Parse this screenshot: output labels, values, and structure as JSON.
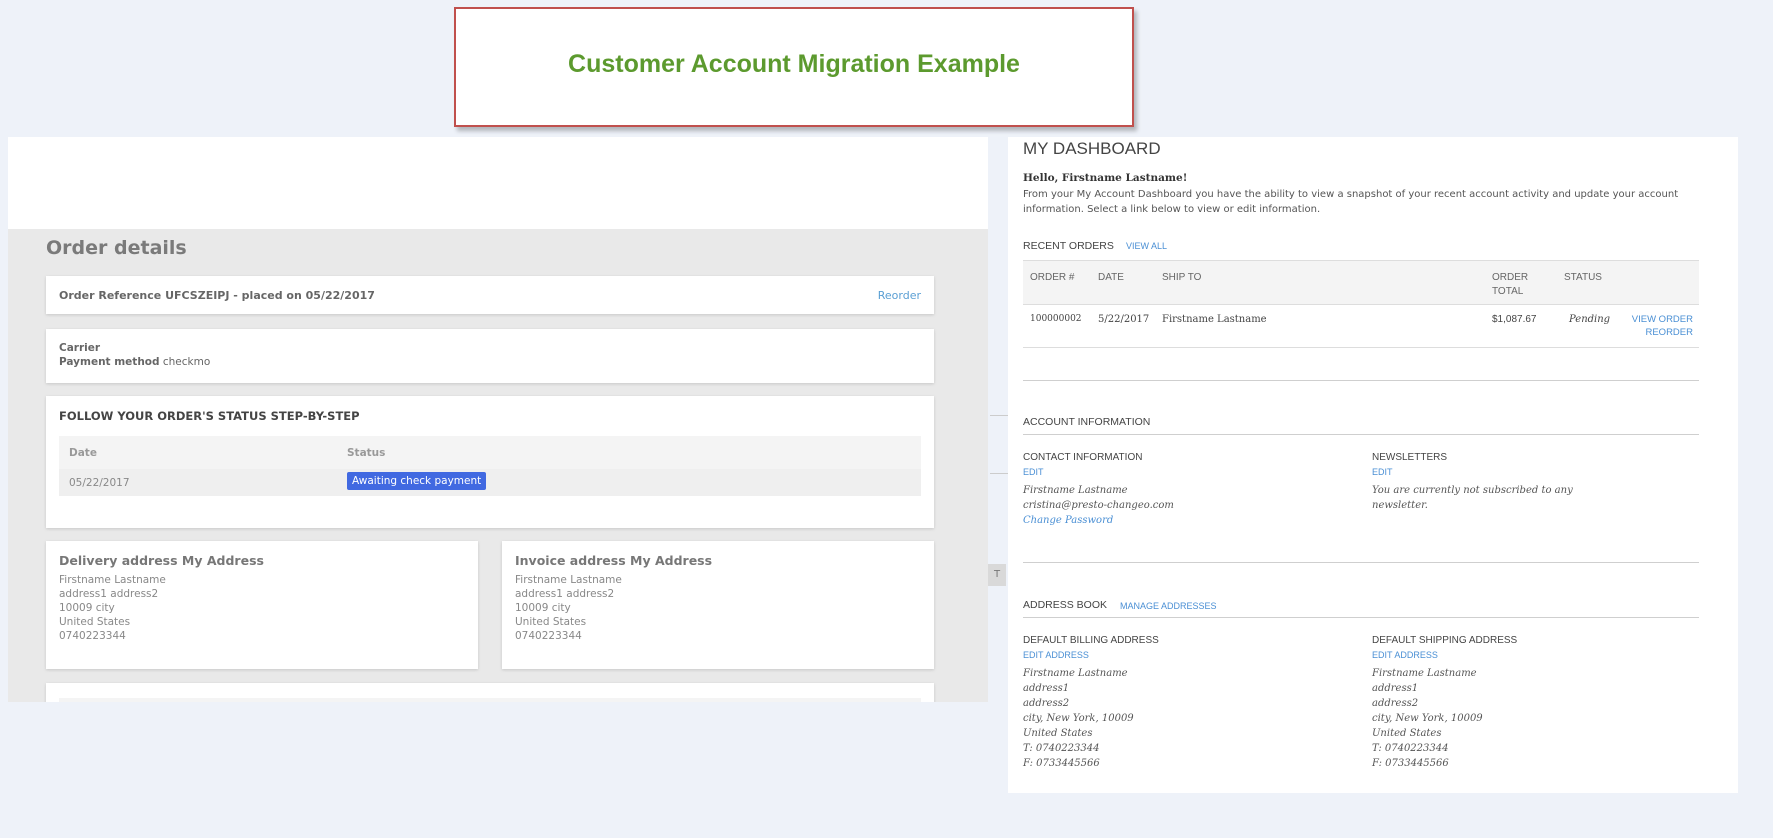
{
  "banner": {
    "title": "Customer Account Migration Example"
  },
  "left": {
    "order_details_title": "Order details",
    "order_reference": "Order Reference UFCSZEIPJ - placed on 05/22/2017",
    "reorder": "Reorder",
    "carrier_label": "Carrier",
    "payment_label": "Payment method",
    "payment_value": "checkmo",
    "follow_title": "FOLLOW YOUR ORDER'S STATUS STEP-BY-STEP",
    "status_table": {
      "headers": [
        "Date",
        "Status"
      ],
      "rows": [
        {
          "date": "05/22/2017",
          "status": "Awaiting check payment"
        }
      ]
    },
    "delivery": {
      "title": "Delivery address My Address",
      "lines": [
        "Firstname Lastname",
        "address1 address2",
        "10009 city",
        "United States",
        "0740223344"
      ]
    },
    "invoice": {
      "title": "Invoice address My Address",
      "lines": [
        "Firstname Lastname",
        "address1 address2",
        "10009 city",
        "United States",
        "0740223344"
      ]
    },
    "side_tab": "T"
  },
  "right": {
    "dashboard_title": "MY DASHBOARD",
    "hello": "Hello, Firstname Lastname!",
    "intro": "From your My Account Dashboard you have the ability to view a snapshot of your recent account activity and update your account information. Select a link below to view or edit information.",
    "recent_orders": "RECENT ORDERS",
    "view_all": "VIEW ALL",
    "orders_table": {
      "headers": {
        "order": "ORDER #",
        "date": "DATE",
        "ship_to": "SHIP TO",
        "total_1": "ORDER",
        "total_2": "TOTAL",
        "status": "STATUS"
      },
      "row": {
        "order": "100000002",
        "date": "5/22/2017",
        "ship_to": "Firstname Lastname",
        "total": "$1,087.67",
        "status": "Pending",
        "view_order": "VIEW ORDER",
        "reorder": "REORDER"
      }
    },
    "account_information": "ACCOUNT INFORMATION",
    "contact_information": "CONTACT INFORMATION",
    "contact_edit": "EDIT",
    "contact_name": "Firstname Lastname",
    "contact_email": "cristina@presto-changeo.com",
    "change_password": "Change Password",
    "newsletters": "NEWSLETTERS",
    "newsletters_edit": "EDIT",
    "newsletters_text_1": "You are currently not subscribed to any",
    "newsletters_text_2": "newsletter.",
    "address_book": "ADDRESS BOOK",
    "manage_addresses": "MANAGE ADDRESSES",
    "billing": {
      "title": "DEFAULT BILLING ADDRESS",
      "edit": "EDIT ADDRESS",
      "lines": [
        "Firstname Lastname",
        "address1",
        "address2",
        "city, New York, 10009",
        "United States",
        "T: 0740223344",
        "F: 0733445566"
      ]
    },
    "shipping": {
      "title": "DEFAULT SHIPPING ADDRESS",
      "edit": "EDIT ADDRESS",
      "lines": [
        "Firstname Lastname",
        "address1",
        "address2",
        "city, New York, 10009",
        "United States",
        "T: 0740223344",
        "F: 0733445566"
      ]
    }
  }
}
